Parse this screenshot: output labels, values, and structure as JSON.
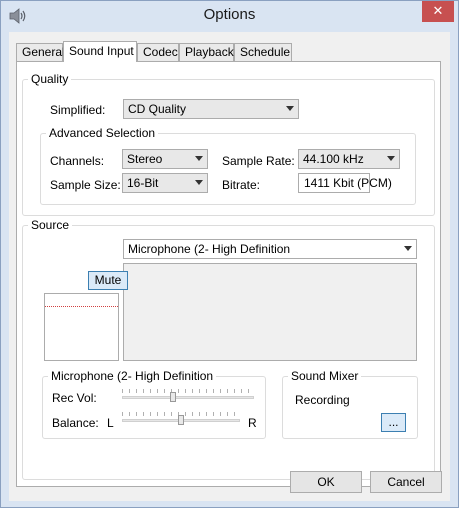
{
  "window": {
    "title": "Options",
    "close_label": "✕"
  },
  "tabs": [
    "General",
    "Sound Input",
    "Codec",
    "Playback",
    "Schedule"
  ],
  "quality": {
    "group_label": "Quality",
    "simplified_label": "Simplified:",
    "simplified_value": "CD Quality",
    "advanced": {
      "group_label": "Advanced Selection",
      "channels_label": "Channels:",
      "channels_value": "Stereo",
      "sample_size_label": "Sample Size:",
      "sample_size_value": "16-Bit",
      "sample_rate_label": "Sample Rate:",
      "sample_rate_value": "44.100 kHz",
      "bitrate_label": "Bitrate:",
      "bitrate_value": "1411 Kbit (PCM)"
    }
  },
  "source": {
    "group_label": "Source",
    "device_value": "Microphone (2- High Definition",
    "mute_label": "Mute",
    "levels": {
      "group_label": "Microphone (2- High Definition",
      "rec_vol_label": "Rec Vol:",
      "rec_vol_level": 0.39,
      "balance_label": "Balance:",
      "balance_left": "L",
      "balance_right": "R",
      "balance_level": 0.5
    },
    "mixer": {
      "group_label": "Sound Mixer",
      "recording_label": "Recording",
      "more_button": "..."
    }
  },
  "footer": {
    "ok_label": "OK",
    "cancel_label": "Cancel"
  }
}
